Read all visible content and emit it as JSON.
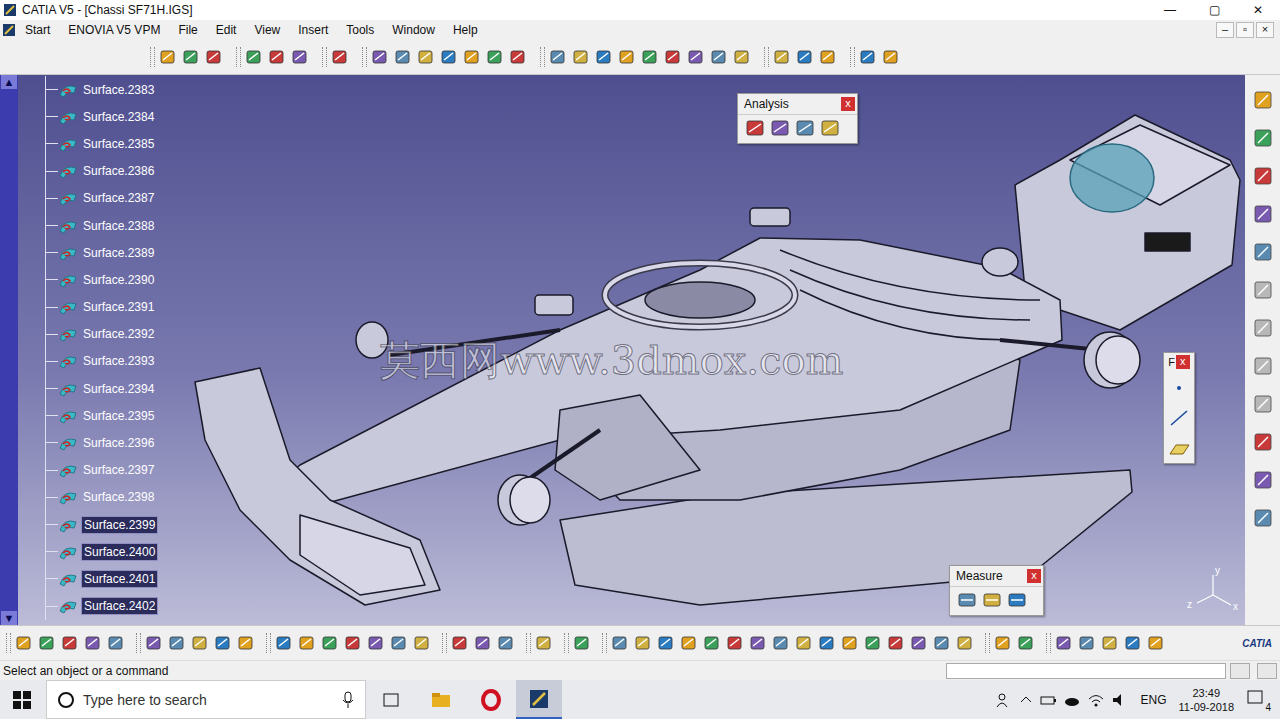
{
  "window": {
    "title": "CATIA V5 - [Chassi SF71H.IGS]",
    "controls": [
      "—",
      "▢",
      "✕"
    ],
    "doc_controls": [
      "–",
      "▫",
      "×"
    ]
  },
  "menu": [
    {
      "label": "Start"
    },
    {
      "label": "ENOVIA V5 VPM"
    },
    {
      "label": "File"
    },
    {
      "label": "Edit"
    },
    {
      "label": "View"
    },
    {
      "label": "Insert"
    },
    {
      "label": "Tools"
    },
    {
      "label": "Window"
    },
    {
      "label": "Help"
    }
  ],
  "scrollbar": {
    "up": "▲",
    "down": "▼"
  },
  "tree": {
    "items": [
      {
        "label": "Surface.2383",
        "selected": false
      },
      {
        "label": "Surface.2384",
        "selected": false
      },
      {
        "label": "Surface.2385",
        "selected": false
      },
      {
        "label": "Surface.2386",
        "selected": false
      },
      {
        "label": "Surface.2387",
        "selected": false
      },
      {
        "label": "Surface.2388",
        "selected": false
      },
      {
        "label": "Surface.2389",
        "selected": false
      },
      {
        "label": "Surface.2390",
        "selected": false
      },
      {
        "label": "Surface.2391",
        "selected": false
      },
      {
        "label": "Surface.2392",
        "selected": false
      },
      {
        "label": "Surface.2393",
        "selected": false
      },
      {
        "label": "Surface.2394",
        "selected": false
      },
      {
        "label": "Surface.2395",
        "selected": false
      },
      {
        "label": "Surface.2396",
        "selected": false
      },
      {
        "label": "Surface.2397",
        "selected": false
      },
      {
        "label": "Surface.2398",
        "selected": false
      },
      {
        "label": "Surface.2399",
        "selected": true
      },
      {
        "label": "Surface.2400",
        "selected": true
      },
      {
        "label": "Surface.2401",
        "selected": true
      },
      {
        "label": "Surface.2402",
        "selected": true
      }
    ]
  },
  "watermark": "莫西网www.3dmox.com",
  "analysis": {
    "title": "Analysis",
    "close": "x"
  },
  "measure": {
    "title": "Measure",
    "close": "x"
  },
  "float_toolbar": {
    "title": "F",
    "close": "x"
  },
  "axes": {
    "x": "x",
    "y": "y",
    "z": "z"
  },
  "logo": "CATIA",
  "status_bar": {
    "text": "Select an object or a command"
  },
  "taskbar": {
    "search_placeholder": "Type here to search",
    "language": "ENG",
    "time": "23:49",
    "date": "11-09-2018",
    "notifications": "4"
  }
}
